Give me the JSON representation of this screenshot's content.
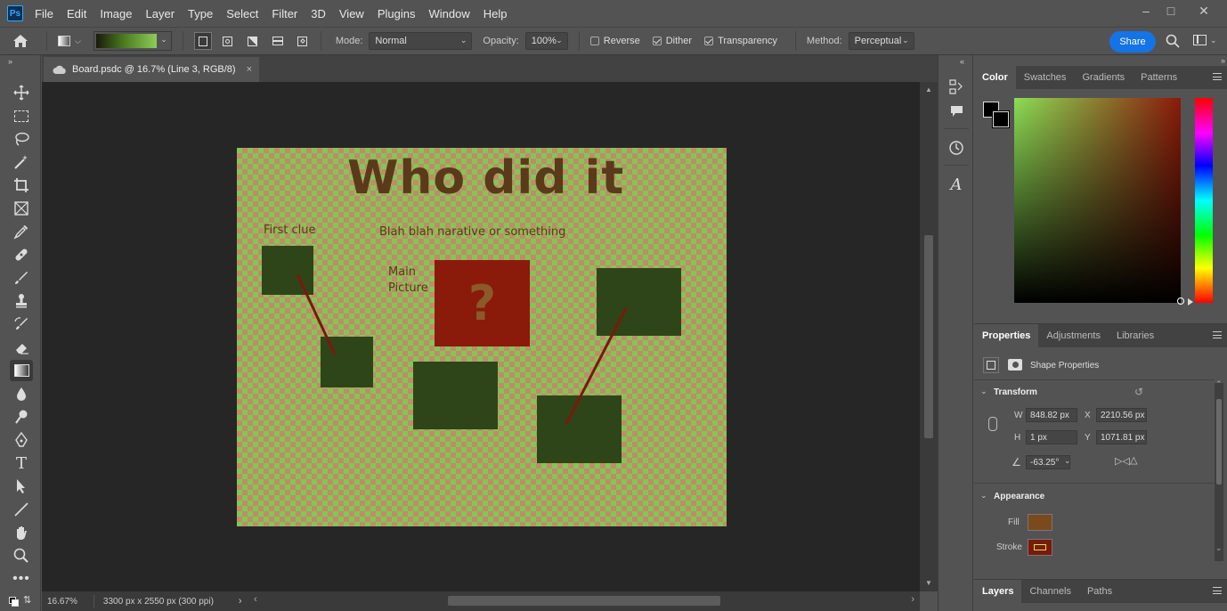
{
  "app": {
    "logo": "Ps"
  },
  "menu": [
    "File",
    "Edit",
    "Image",
    "Layer",
    "Type",
    "Select",
    "Filter",
    "3D",
    "View",
    "Plugins",
    "Window",
    "Help"
  ],
  "options": {
    "mode_label": "Mode:",
    "mode_value": "Normal",
    "opacity_label": "Opacity:",
    "opacity_value": "100%",
    "reverse_label": "Reverse",
    "reverse_checked": false,
    "dither_label": "Dither",
    "dither_checked": true,
    "transparency_label": "Transparency",
    "transparency_checked": true,
    "method_label": "Method:",
    "method_value": "Perceptual",
    "share_label": "Share"
  },
  "document": {
    "tab_title": "Board.psdc @ 16.7% (Line 3, RGB/8)",
    "zoom": "16.67%",
    "doc_info": "3300 px x 2550 px (300 ppi)"
  },
  "board": {
    "title": "Who did it",
    "first_clue": "First clue",
    "narrative": "Blah blah narative or something",
    "main_picture_line1": "Main",
    "main_picture_line2": "Picture",
    "question_mark": "?"
  },
  "color_panel": {
    "tabs": [
      "Color",
      "Swatches",
      "Gradients",
      "Patterns"
    ],
    "active_tab": "Color"
  },
  "properties_panel": {
    "tabs": [
      "Properties",
      "Adjustments",
      "Libraries"
    ],
    "active_tab": "Properties",
    "heading": "Shape Properties",
    "transform_label": "Transform",
    "w_label": "W",
    "w_value": "848.82 px",
    "h_label": "H",
    "h_value": "1 px",
    "x_label": "X",
    "x_value": "2210.56 px",
    "y_label": "Y",
    "y_value": "1071.81 px",
    "angle_value": "-63.25°",
    "appearance_label": "Appearance",
    "fill_label": "Fill",
    "stroke_label": "Stroke",
    "fill_color": "#7a4a1c",
    "stroke_color": "#7a1a0a"
  },
  "layers_panel": {
    "tabs": [
      "Layers",
      "Channels",
      "Paths"
    ],
    "active_tab": "Layers"
  },
  "colors": {
    "board_green": "#7ec858",
    "board_box": "#2e4519",
    "main_picture": "#8a1a0a",
    "accent": "#1473e6"
  }
}
